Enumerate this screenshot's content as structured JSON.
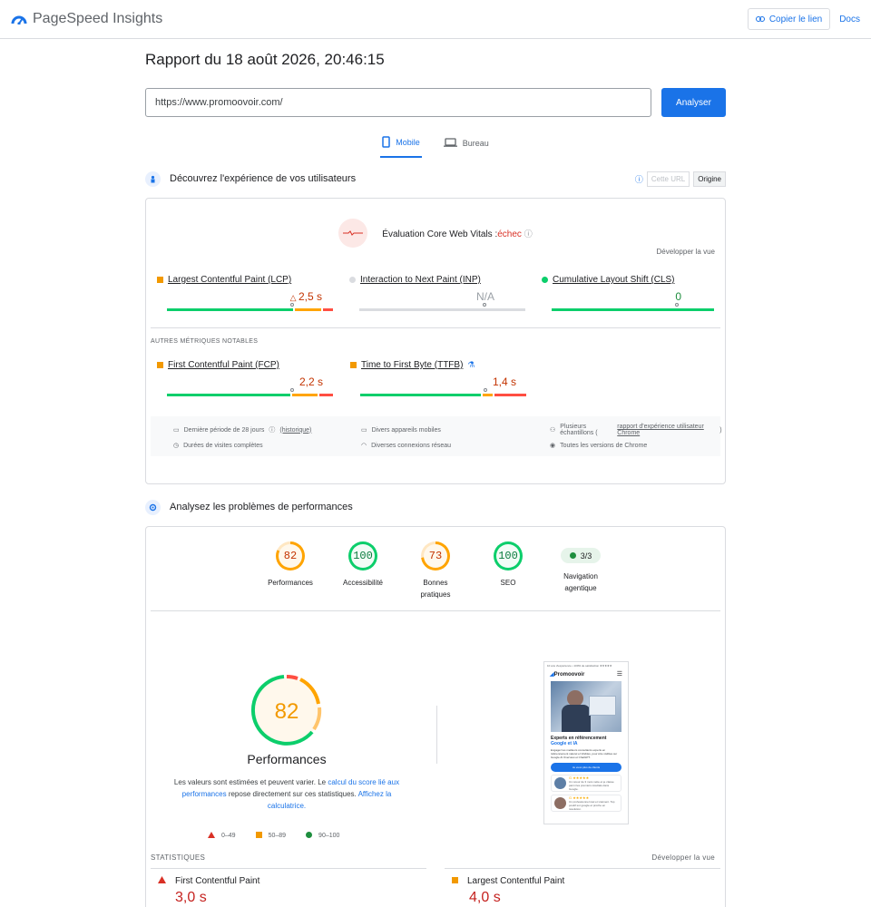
{
  "header": {
    "app_title": "PageSpeed Insights",
    "copy_link_label": "Copier le lien",
    "docs_label": "Docs"
  },
  "report": {
    "title": "Rapport du 18 août 2026, 20:46:15",
    "url_value": "https://www.promoovoir.com/",
    "analyze_label": "Analyser"
  },
  "tabs": [
    {
      "label": "Mobile",
      "active": true,
      "icon": "phone-icon"
    },
    {
      "label": "Bureau",
      "active": false,
      "icon": "laptop-icon"
    }
  ],
  "crux": {
    "section_title": "Découvrez l'expérience de vos utilisateurs",
    "toggle_url": "Cette URL",
    "toggle_origin": "Origine",
    "cwv_label": "Évaluation Core Web Vitals :",
    "cwv_status": "échec",
    "expand_label": "Développer la vue",
    "other_metrics_label": "AUTRES MÉTRIQUES NOTABLES",
    "metrics": [
      {
        "name": "Largest Contentful Paint (LCP)",
        "value": "2,5 s",
        "status": "average",
        "distribution": [
          0.76,
          0.17,
          0.07
        ],
        "marker": 0.75
      },
      {
        "name": "Interaction to Next Paint (INP)",
        "value": "N/A",
        "status": "na",
        "distribution": [
          1,
          0,
          0
        ],
        "marker": 0.75
      },
      {
        "name": "Cumulative Layout Shift (CLS)",
        "value": "0",
        "status": "good",
        "distribution": [
          0.98,
          0.01,
          0.01
        ],
        "marker": 0.75
      }
    ],
    "other_metrics": [
      {
        "name": "First Contentful Paint (FCP)",
        "value": "2,2 s",
        "status": "average",
        "distribution": [
          0.75,
          0.16,
          0.09
        ],
        "marker": 0.75
      },
      {
        "name": "Time to First Byte (TTFB)",
        "value": "1,4 s",
        "status": "average",
        "distribution": [
          0.73,
          0.07,
          0.2
        ],
        "marker": 0.75
      }
    ],
    "info": {
      "period": "Dernière période de 28 jours",
      "history_link": "(historique)",
      "devices": "Divers appareils mobiles",
      "samples_prefix": "Plusieurs échantillons (",
      "samples_link": "rapport d'expérience utilisateur Chrome",
      "samples_suffix": ")",
      "durations": "Durées de visites complètes",
      "connections": "Diverses connexions réseau",
      "chrome_versions": "Toutes les versions de Chrome"
    }
  },
  "lab": {
    "section_title": "Analysez les problèmes de performances",
    "gauges": [
      {
        "label": "Performances",
        "score": 82,
        "status": "average"
      },
      {
        "label": "Accessibilité",
        "score": 100,
        "status": "good"
      },
      {
        "label": "Bonnes pratiques",
        "score": 73,
        "status": "average"
      },
      {
        "label": "SEO",
        "score": 100,
        "status": "good"
      }
    ],
    "agentic": {
      "label": "Navigation agentique",
      "value": "3/3"
    },
    "performance": {
      "score": "82",
      "score_fraction": 0.82,
      "title": "Performances",
      "desc_1": "Les valeurs sont estimées et peuvent varier. Le ",
      "desc_link_1": "calcul du score lié aux performances",
      "desc_2": " repose directement sur ces statistiques. ",
      "desc_link_2": "Affichez la calculatrice."
    },
    "legend": [
      {
        "range": "0–49",
        "shape": "triangle",
        "color": "#d93025"
      },
      {
        "range": "50–89",
        "shape": "square",
        "color": "#f29900"
      },
      {
        "range": "90–100",
        "shape": "circle",
        "color": "#1e8e3e"
      }
    ],
    "screenshot": {
      "banner": "10 ans d'expérience • 100% de satisfaction ★★★★★",
      "logo": "Promoovoir",
      "headline": "Experts en référencement",
      "headline_accent": "Google et IA",
      "body": "Engagez les meilleurs consultants experts en référencement naturel et Visibles, pour être visibles sur Google AI Overview et ChatGPT.",
      "cta": "Je veux plus de clients",
      "review_1": "Un retour de 3 mois nette et je classe parmi les premiers résultats dans Google.",
      "review_2": "Un professionnel réel et vraiment. Top positif sur google et proche en résolution."
    },
    "stats": {
      "heading": "STATISTIQUES",
      "expand_label": "Développer la vue",
      "items": [
        {
          "label": "First Contentful Paint",
          "value": "3,0 s",
          "status": "poor"
        },
        {
          "label": "Largest Contentful Paint",
          "value": "4,0 s",
          "status": "poor"
        }
      ]
    }
  },
  "colors": {
    "accent": "#1a73e8",
    "good": "#0cce6b",
    "average": "#ffa400",
    "poor": "#ff4e42",
    "text_average": "#c33300",
    "text_poor": "#c5221f"
  }
}
